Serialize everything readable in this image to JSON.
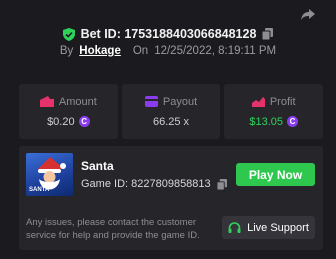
{
  "header": {
    "bet_id_label": "Bet ID: 1753188403066848128",
    "by_label": "By",
    "username": "Hokage",
    "on_label": "On",
    "timestamp": "12/25/2022, 8:19:11 PM",
    "icons": [
      "share-icon",
      "verified-shield-icon",
      "copy-icon"
    ],
    "colors": {
      "shield": "#2fd35c"
    }
  },
  "stats": [
    {
      "label": "Amount",
      "value": "$0.20",
      "icon": "wallet-icon",
      "coin": true
    },
    {
      "label": "Payout",
      "value": "66.25 x",
      "icon": "card-icon",
      "coin": false
    },
    {
      "label": "Profit",
      "value": "$13.05",
      "icon": "profit-icon",
      "coin": true
    }
  ],
  "game": {
    "name": "Santa",
    "thumbnail_text": "SANTA",
    "game_id_label": "Game ID: 8227809858813",
    "play_label": "Play Now",
    "support_text": "Any issues, please contact the customer service for help and provide the game ID.",
    "support_label": "Live Support"
  },
  "colors": {
    "accent_pink": "#e5326a",
    "accent_purple": "#8b3cf0",
    "profit_green": "#2fd35c",
    "play_button": "#2ec84e"
  }
}
